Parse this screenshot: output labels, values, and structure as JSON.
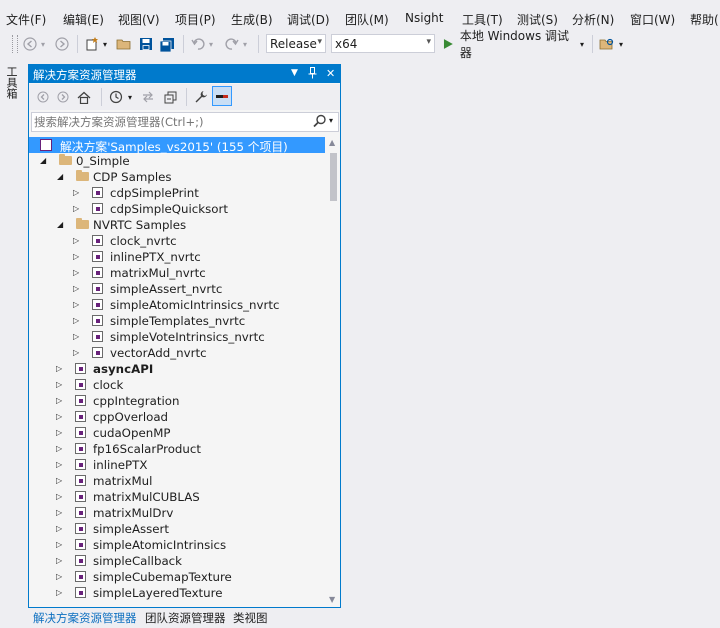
{
  "menubar": {
    "items": [
      "文件(F)",
      "编辑(E)",
      "视图(V)",
      "项目(P)",
      "生成(B)",
      "调试(D)",
      "团队(M)",
      "Nsight",
      "工具(T)",
      "测试(S)",
      "分析(N)",
      "窗口(W)",
      "帮助("
    ]
  },
  "toolbar": {
    "config": "Release",
    "platform": "x64",
    "run_label": "本地 Windows 调试器"
  },
  "sidestrip": {
    "label": "工具箱"
  },
  "panel": {
    "title": "解决方案资源管理器",
    "search_placeholder": "搜索解决方案资源管理器(Ctrl+;)",
    "solution_label": "解决方案'Samples_vs2015' (155 个项目)",
    "folder_0": "0_Simple",
    "cdp_folder": "CDP Samples",
    "cdp_items": [
      "cdpSimplePrint",
      "cdpSimpleQuicksort"
    ],
    "nvrtc_folder": "NVRTC Samples",
    "nvrtc_items": [
      "clock_nvrtc",
      "inlinePTX_nvrtc",
      "matrixMul_nvrtc",
      "simpleAssert_nvrtc",
      "simpleAtomicIntrinsics_nvrtc",
      "simpleTemplates_nvrtc",
      "simpleVoteIntrinsics_nvrtc",
      "vectorAdd_nvrtc"
    ],
    "projects": [
      "asyncAPI",
      "clock",
      "cppIntegration",
      "cppOverload",
      "cudaOpenMP",
      "fp16ScalarProduct",
      "inlinePTX",
      "matrixMul",
      "matrixMulCUBLAS",
      "matrixMulDrv",
      "simpleAssert",
      "simpleAtomicIntrinsics",
      "simpleCallback",
      "simpleCubemapTexture",
      "simpleLayeredTexture"
    ]
  },
  "bottom_tabs": [
    "解决方案资源管理器",
    "团队资源管理器",
    "类视图"
  ],
  "colors": {
    "accent": "#007acc",
    "selection": "#3399ff",
    "run_green": "#388a34"
  }
}
